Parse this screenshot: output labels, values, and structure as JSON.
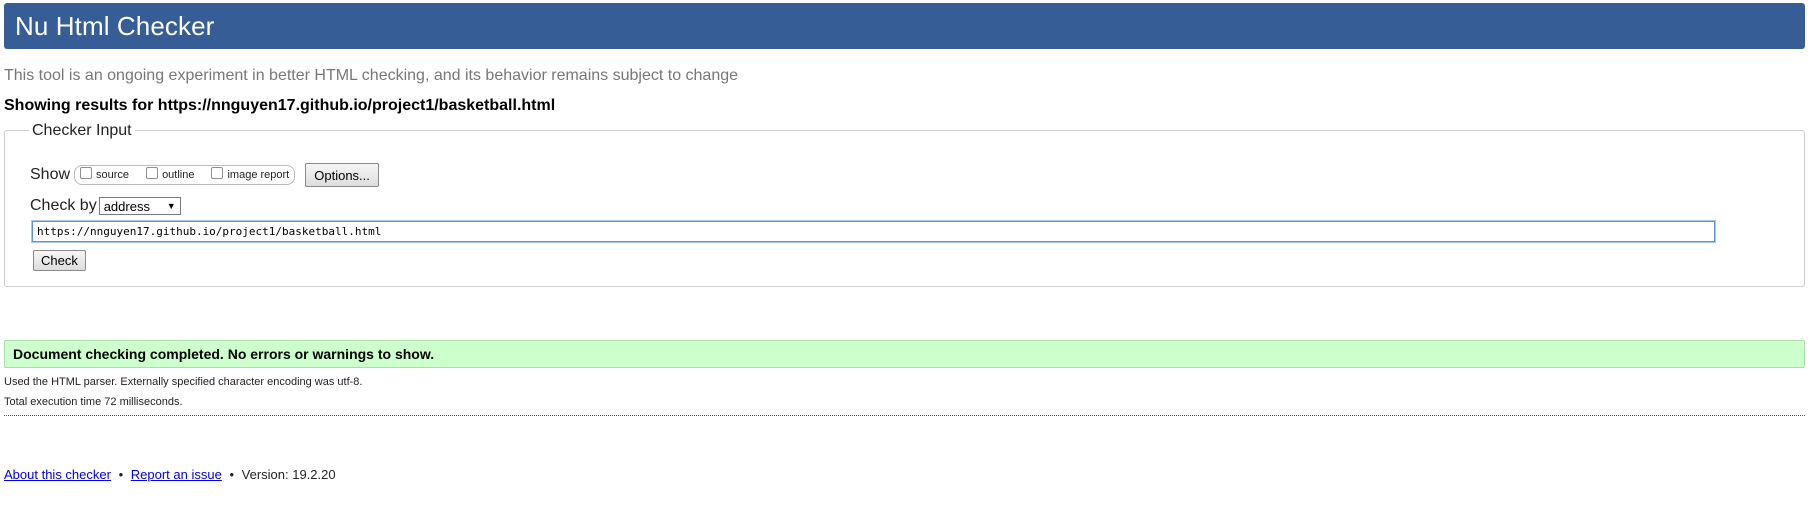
{
  "header": {
    "title": "Nu Html Checker"
  },
  "tagline": "This tool is an ongoing experiment in better HTML checking, and its behavior remains subject to change",
  "showing": "Showing results for https://nnguyen17.github.io/project1/basketball.html",
  "checker_input": {
    "legend": "Checker Input",
    "show_label": "Show",
    "options": [
      {
        "label": "source",
        "checked": false
      },
      {
        "label": "outline",
        "checked": false
      },
      {
        "label": "image report",
        "checked": false
      }
    ],
    "options_button": "Options...",
    "check_by_label": "Check by",
    "check_by_value": "address",
    "url_value": "https://nnguyen17.github.io/project1/basketball.html",
    "check_button": "Check"
  },
  "result": {
    "message": "Document checking completed. No errors or warnings to show.",
    "info_1": "Used the HTML parser. Externally specified character encoding was utf-8.",
    "info_2": "Total execution time 72 milliseconds."
  },
  "footer": {
    "about_link": "About this checker",
    "separator": "•",
    "report_link": "Report an issue",
    "version_text": "Version: 19.2.20"
  },
  "colors": {
    "header_bg": "#365d95",
    "success_bg": "#ccffcc",
    "link": "#0000ee"
  }
}
